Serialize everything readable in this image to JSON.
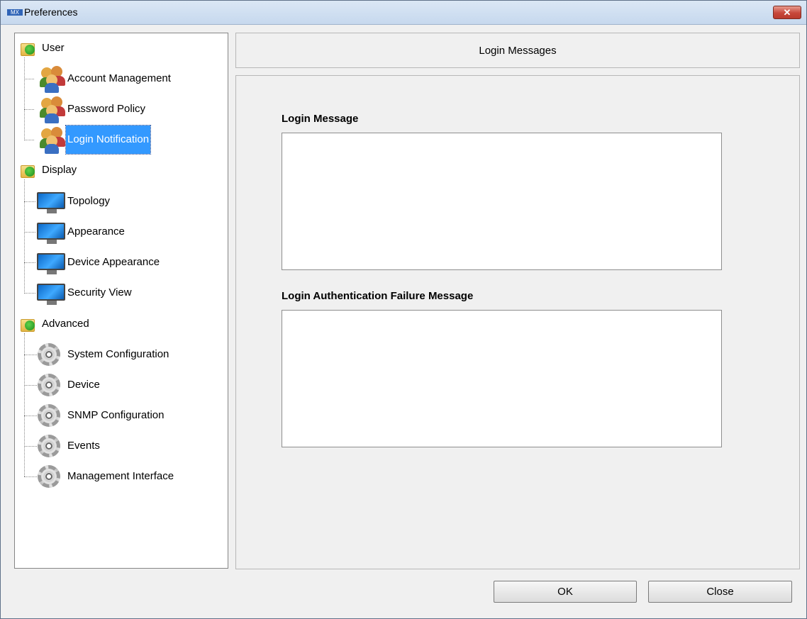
{
  "window": {
    "title": "Preferences",
    "app_icon_text": "MX"
  },
  "tree": {
    "groups": [
      {
        "label": "User",
        "items": [
          {
            "label": "Account Management"
          },
          {
            "label": "Password Policy"
          },
          {
            "label": "Login Notification",
            "selected": true
          }
        ]
      },
      {
        "label": "Display",
        "items": [
          {
            "label": "Topology"
          },
          {
            "label": "Appearance"
          },
          {
            "label": "Device Appearance"
          },
          {
            "label": "Security View"
          }
        ]
      },
      {
        "label": "Advanced",
        "items": [
          {
            "label": "System Configuration"
          },
          {
            "label": "Device"
          },
          {
            "label": "SNMP Configuration"
          },
          {
            "label": "Events"
          },
          {
            "label": "Management Interface"
          }
        ]
      }
    ]
  },
  "main": {
    "header": "Login Messages",
    "login_message_label": "Login Message",
    "login_message_value": "",
    "failure_message_label": "Login Authentication Failure Message",
    "failure_message_value": ""
  },
  "buttons": {
    "ok": "OK",
    "close": "Close"
  },
  "colors": {
    "selection": "#3399ff",
    "close_button": "#c7473a"
  }
}
